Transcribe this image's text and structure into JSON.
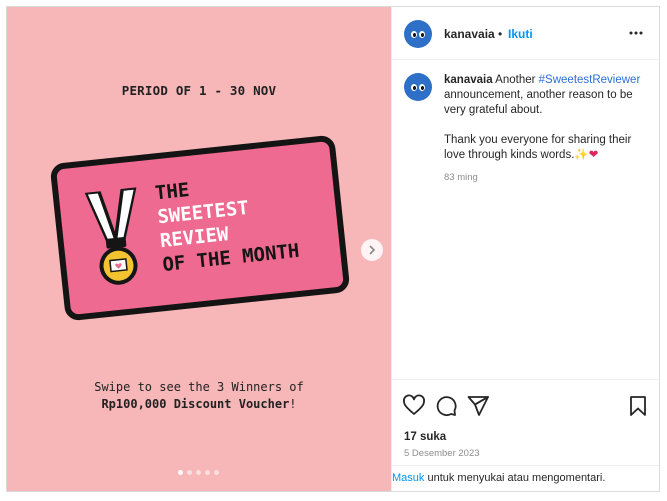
{
  "post": {
    "period_text": "PERIOD OF 1 - 30 NOV",
    "card": {
      "line1": "THE",
      "line2": "SWEETEST",
      "line3": "REVIEW",
      "line4": "OF THE MONTH"
    },
    "swipe_line1": "Swipe to see the 3 Winners of",
    "swipe_line2_bold": "Rp100,000 Discount Voucher",
    "swipe_line2_end": "!",
    "carousel": {
      "total": 5,
      "active_index": 0
    }
  },
  "header": {
    "username": "kanavaia",
    "separator": "•",
    "follow_label": "Ikuti",
    "more_icon": "more-horizontal-icon"
  },
  "caption": {
    "username": "kanavaia",
    "text_before_tag": " Another ",
    "hashtag": "#SweetestReviewer",
    "text_after_tag": " announcement, another reason to be very grateful about.",
    "paragraph2": "Thank you everyone for sharing their love through kinds words.",
    "emojis": "✨❤",
    "time": "83 ming"
  },
  "actions": {
    "likes": "17 suka",
    "date": "5 Desember 2023"
  },
  "footer": {
    "login_link": "Masuk",
    "login_text": " untuk menyukai atau mengomentari."
  },
  "colors": {
    "media_bg": "#f7b6b8",
    "card_bg": "#ef6a90",
    "follow_blue": "#0095f6",
    "avatar_blue": "#2e6fc7"
  }
}
